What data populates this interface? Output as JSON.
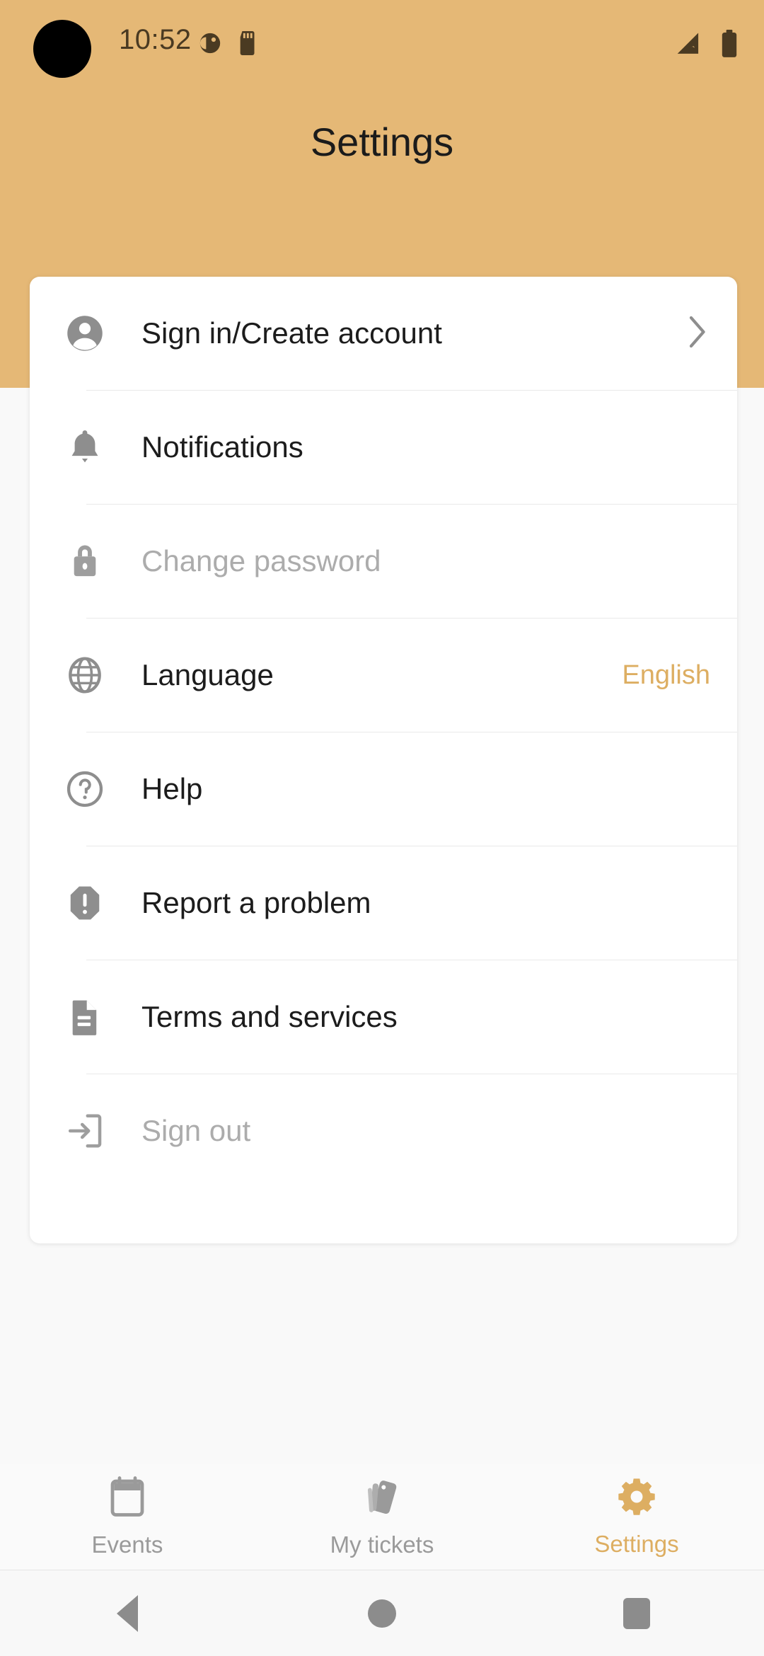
{
  "status_bar": {
    "time": "10:52",
    "left_icons": [
      "do-not-disturb-icon",
      "sd-card-icon"
    ],
    "right_icons": [
      "signal-no-service-icon",
      "battery-full-icon"
    ]
  },
  "header": {
    "title": "Settings",
    "background_color": "#E5B876",
    "title_color": "#1B1B1B"
  },
  "theme": {
    "accent_color": "#DDAE62",
    "card_background": "#FFFFFF",
    "page_background": "#F9F9F9",
    "icon_color": "#8E8E8E",
    "text_color": "#1C1C1C",
    "disabled_text_color": "#ACACAC",
    "divider_color": "#E9E9E9"
  },
  "settings_list": {
    "items": [
      {
        "id": "sign-in",
        "label": "Sign in/Create account",
        "icon": "account-circle-icon",
        "disabled": false,
        "value": "",
        "has_chevron": true
      },
      {
        "id": "notifications",
        "label": "Notifications",
        "icon": "bell-icon",
        "disabled": false,
        "value": "",
        "has_chevron": false
      },
      {
        "id": "change-password",
        "label": "Change password",
        "icon": "lock-icon",
        "disabled": true,
        "value": "",
        "has_chevron": false
      },
      {
        "id": "language",
        "label": "Language",
        "icon": "globe-icon",
        "disabled": false,
        "value": "English",
        "has_chevron": false
      },
      {
        "id": "help",
        "label": "Help",
        "icon": "question-circle-icon",
        "disabled": false,
        "value": "",
        "has_chevron": false
      },
      {
        "id": "report-problem",
        "label": "Report a problem",
        "icon": "alert-octagon-icon",
        "disabled": false,
        "value": "",
        "has_chevron": false
      },
      {
        "id": "terms-services",
        "label": "Terms and services",
        "icon": "document-icon",
        "disabled": false,
        "value": "",
        "has_chevron": false
      },
      {
        "id": "sign-out",
        "label": "Sign out",
        "icon": "logout-icon",
        "disabled": true,
        "value": "",
        "has_chevron": false
      }
    ]
  },
  "tab_bar": {
    "items": [
      {
        "id": "events",
        "label": "Events",
        "icon": "calendar-icon",
        "active": false
      },
      {
        "id": "my-tickets",
        "label": "My tickets",
        "icon": "tickets-icon",
        "active": false
      },
      {
        "id": "settings",
        "label": "Settings",
        "icon": "gear-icon",
        "active": true
      }
    ]
  },
  "android_nav": {
    "buttons": [
      "back-button",
      "home-button",
      "recents-button"
    ]
  }
}
